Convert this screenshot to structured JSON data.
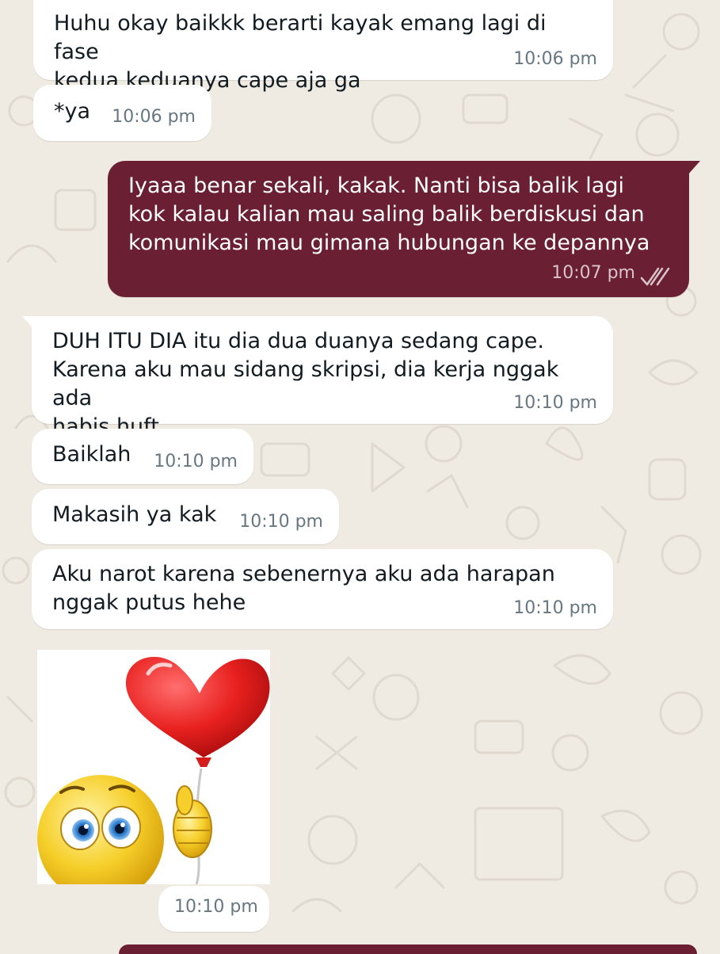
{
  "colors": {
    "background": "#efeae2",
    "incoming": "#ffffff",
    "outgoing": "#6b1f33",
    "timestamp": "#667781"
  },
  "messages": [
    {
      "id": "m1",
      "direction": "in",
      "text": "Huhu okay baikkk berarti kayak emang lagi di fase\nkedua keduanya cape aja ga",
      "time": "10:06 pm"
    },
    {
      "id": "m2",
      "direction": "in",
      "text": "*ya",
      "time": "10:06 pm"
    },
    {
      "id": "m3",
      "direction": "out",
      "text": "Iyaaa benar sekali, kakak. Nanti bisa balik lagi\nkok kalau kalian mau saling balik berdiskusi dan\nkomunikasi mau gimana hubungan ke depannya",
      "time": "10:07 pm",
      "status": "read-ticks-icon"
    },
    {
      "id": "m4",
      "direction": "in",
      "text": "DUH ITU DIA itu dia dua duanya sedang cape.\nKarena aku mau sidang skripsi, dia kerja nggak ada\nhabis huft",
      "time": "10:10 pm"
    },
    {
      "id": "m5",
      "direction": "in",
      "text": "Baiklah",
      "time": "10:10 pm"
    },
    {
      "id": "m6",
      "direction": "in",
      "text": "Makasih ya kak",
      "time": "10:10 pm"
    },
    {
      "id": "m7",
      "direction": "in",
      "text": "Aku narot karena sebenernya aku ada harapan\nnggak putus hehe",
      "time": "10:10 pm"
    },
    {
      "id": "m8",
      "direction": "in",
      "type": "sticker",
      "sticker": "smiley-holding-heart-balloon-sticker",
      "time": "10:10 pm"
    }
  ]
}
